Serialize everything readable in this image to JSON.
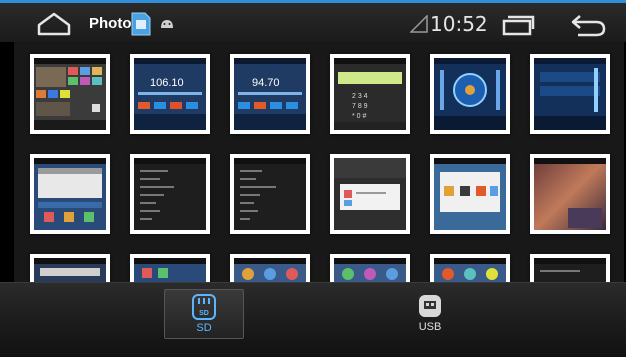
{
  "status_bar": {
    "app_title": "Photo",
    "time": "10:52",
    "accent_color": "#2f8fd8"
  },
  "icons": {
    "home": "home-icon",
    "sd_card": "sd-card-icon",
    "android": "android-icon",
    "signal": "signal-icon",
    "recent_apps": "recent-apps-icon",
    "back": "back-icon",
    "usb": "usb-icon"
  },
  "storage_tabs": [
    {
      "label": "SD",
      "selected": true
    },
    {
      "label": "USB",
      "selected": false
    }
  ],
  "thumbnails": {
    "row1": [
      {
        "theme": "launcher"
      },
      {
        "theme": "radio",
        "text": "106.10"
      },
      {
        "theme": "radio",
        "text": "94.70"
      },
      {
        "theme": "dialpad"
      },
      {
        "theme": "equalizer"
      },
      {
        "theme": "volume"
      }
    ]
  }
}
